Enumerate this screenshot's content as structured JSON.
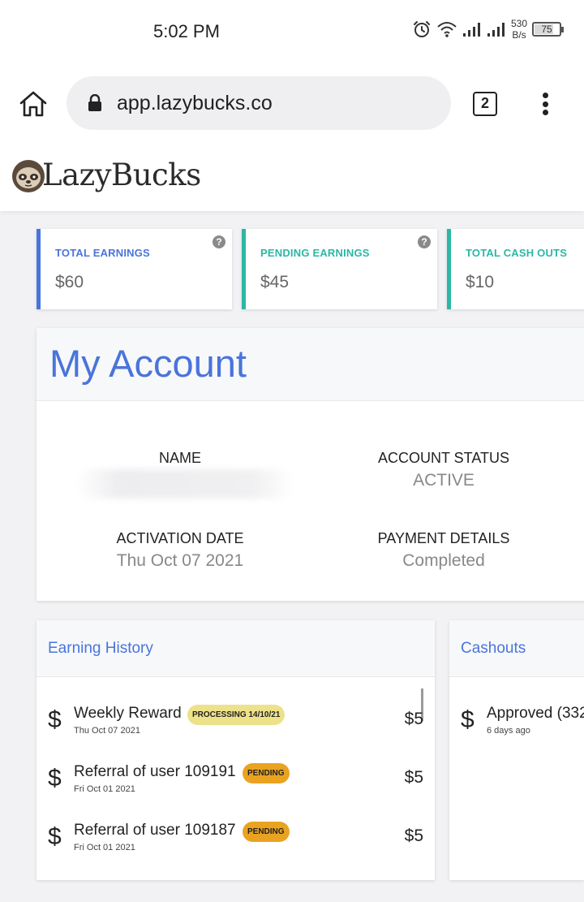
{
  "status_bar": {
    "time": "5:02 PM",
    "speed_value": "530",
    "speed_unit": "B/s",
    "battery": "75",
    "icons": [
      "alarm-icon",
      "wifi-icon",
      "signal-icon",
      "signal-icon",
      "battery-icon"
    ]
  },
  "browser": {
    "url": "app.lazybucks.co",
    "tab_count": "2",
    "icons": [
      "home-icon",
      "lock-icon",
      "tabs-icon",
      "more-vert-icon"
    ]
  },
  "site": {
    "logo_text": "LazyBucks",
    "logo_icon": "sloth-icon"
  },
  "stats": [
    {
      "label": "TOTAL EARNINGS",
      "value": "$60",
      "color": "#4a74db",
      "help": true
    },
    {
      "label": "PENDING EARNINGS",
      "value": "$45",
      "color": "#2bb7a5",
      "help": true
    },
    {
      "label": "TOTAL CASH OUTS",
      "value": "$10",
      "color": "#2bb7a5",
      "help": false
    }
  ],
  "account": {
    "title": "My Account",
    "name_label": "NAME",
    "status_label": "ACCOUNT STATUS",
    "status_value": "ACTIVE",
    "activation_label": "ACTIVATION DATE",
    "activation_value": "Thu Oct 07 2021",
    "payment_label": "PAYMENT DETAILS",
    "payment_value": "Completed"
  },
  "earning_history": {
    "title": "Earning History",
    "items": [
      {
        "title": "Weekly Reward",
        "date": "Thu Oct 07 2021",
        "badge": "PROCESSING 14/10/21",
        "badge_type": "processing",
        "amount": "$5"
      },
      {
        "title": "Referral of user 109191",
        "date": "Fri Oct 01 2021",
        "badge": "PENDING",
        "badge_type": "pending",
        "amount": "$5"
      },
      {
        "title": "Referral of user 109187",
        "date": "Fri Oct 01 2021",
        "badge": "PENDING",
        "badge_type": "pending",
        "amount": "$5"
      }
    ]
  },
  "cashouts": {
    "title": "Cashouts",
    "items": [
      {
        "title": "Approved (332",
        "date": "6 days ago"
      }
    ]
  },
  "colors": {
    "accent_blue": "#4a74db",
    "accent_teal": "#2bb7a5",
    "badge_processing": "#ede28a",
    "badge_pending": "#e9a321"
  }
}
